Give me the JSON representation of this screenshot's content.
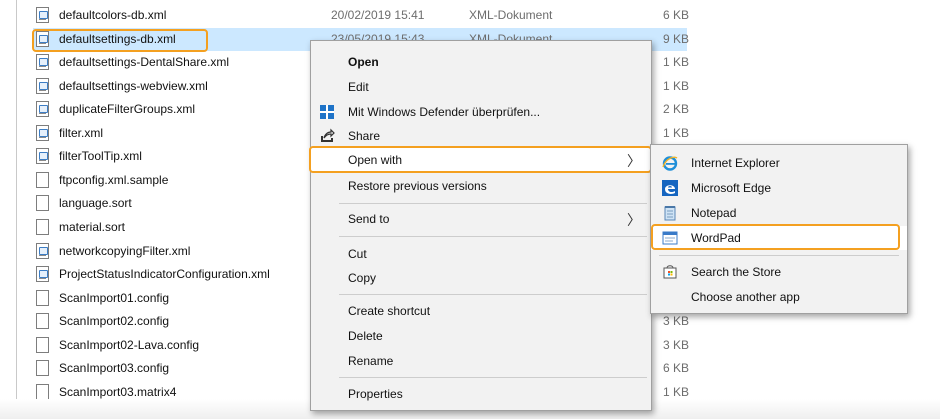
{
  "files": [
    {
      "name": "defaultcolors-db.xml",
      "date": "20/02/2019 15:41",
      "type": "XML-Dokument",
      "size": "6 KB",
      "icon": "xml-file-icon"
    },
    {
      "name": "defaultsettings-db.xml",
      "date": "23/05/2019 15:43",
      "type": "XML-Dokument",
      "size": "9 KB",
      "icon": "xml-file-icon",
      "selected": true
    },
    {
      "name": "defaultsettings-DentalShare.xml",
      "date": "",
      "type": "",
      "size": "1 KB",
      "icon": "xml-file-icon"
    },
    {
      "name": "defaultsettings-webview.xml",
      "date": "",
      "type": "",
      "size": "1 KB",
      "icon": "xml-file-icon"
    },
    {
      "name": "duplicateFilterGroups.xml",
      "date": "",
      "type": "",
      "size": "2 KB",
      "icon": "xml-file-icon"
    },
    {
      "name": "filter.xml",
      "date": "",
      "type": "",
      "size": "1 KB",
      "icon": "xml-file-icon"
    },
    {
      "name": "filterToolTip.xml",
      "date": "",
      "type": "",
      "size": "",
      "icon": "xml-file-icon"
    },
    {
      "name": "ftpconfig.xml.sample",
      "date": "",
      "type": "",
      "size": "",
      "icon": "file-icon"
    },
    {
      "name": "language.sort",
      "date": "",
      "type": "",
      "size": "",
      "icon": "file-icon"
    },
    {
      "name": "material.sort",
      "date": "",
      "type": "",
      "size": "",
      "icon": "file-icon"
    },
    {
      "name": "networkcopyingFilter.xml",
      "date": "",
      "type": "",
      "size": "",
      "icon": "xml-file-icon"
    },
    {
      "name": "ProjectStatusIndicatorConfiguration.xml",
      "date": "",
      "type": "",
      "size": "",
      "icon": "xml-file-icon"
    },
    {
      "name": "ScanImport01.config",
      "date": "",
      "type": "",
      "size": "",
      "icon": "file-icon"
    },
    {
      "name": "ScanImport02.config",
      "date": "",
      "type": "",
      "size": "3 KB",
      "icon": "file-icon"
    },
    {
      "name": "ScanImport02-Lava.config",
      "date": "",
      "type": "",
      "size": "3 KB",
      "icon": "file-icon"
    },
    {
      "name": "ScanImport03.config",
      "date": "",
      "type": "",
      "size": "6 KB",
      "icon": "file-icon"
    },
    {
      "name": "ScanImport03.matrix4",
      "date": "",
      "type": "",
      "size": "1 KB",
      "icon": "file-icon"
    }
  ],
  "context_menu": {
    "open": "Open",
    "edit": "Edit",
    "defender": "Mit Windows Defender überprüfen...",
    "share": "Share",
    "open_with": "Open with",
    "restore": "Restore previous versions",
    "send_to": "Send to",
    "cut": "Cut",
    "copy": "Copy",
    "create_shortcut": "Create shortcut",
    "delete": "Delete",
    "rename": "Rename",
    "properties": "Properties",
    "arrow": "〉"
  },
  "submenu": {
    "internet_explorer": "Internet Explorer",
    "edge": "Microsoft Edge",
    "notepad": "Notepad",
    "wordpad": "WordPad",
    "store": "Search the Store",
    "choose": "Choose another app"
  },
  "colors": {
    "highlight": "#f4a020",
    "selection": "#cce8ff"
  }
}
